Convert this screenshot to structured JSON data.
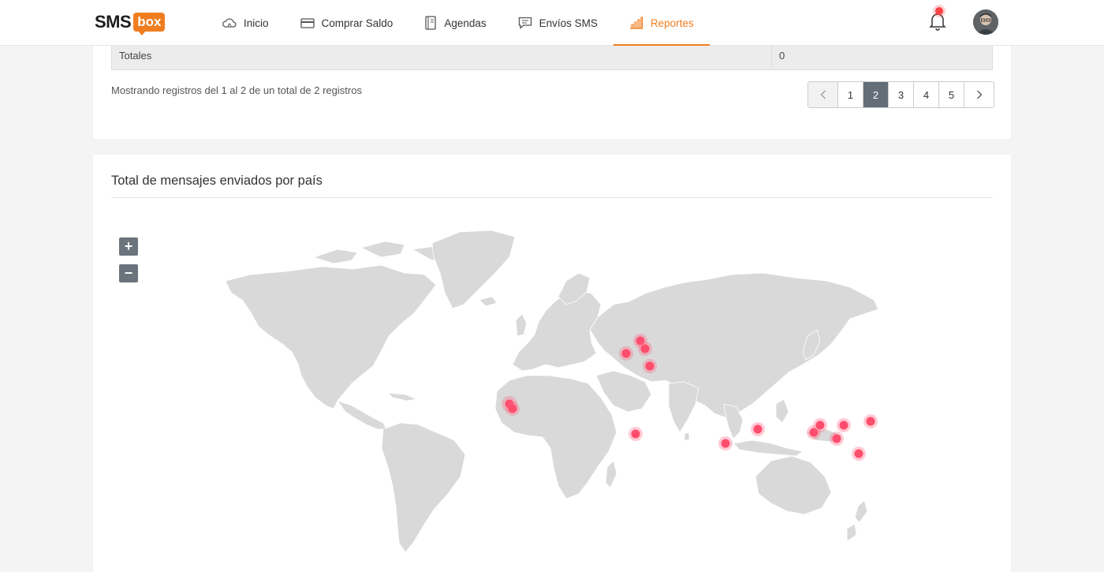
{
  "header": {
    "logo_main": "SMS",
    "logo_accent": "box",
    "nav": [
      {
        "label": "Inicio",
        "icon": "cloud-icon"
      },
      {
        "label": "Comprar Saldo",
        "icon": "credit-card-icon"
      },
      {
        "label": "Agendas",
        "icon": "address-book-icon"
      },
      {
        "label": "Envíos SMS",
        "icon": "message-icon"
      },
      {
        "label": "Reportes",
        "icon": "bar-chart-icon",
        "active": true
      }
    ],
    "accent_color": "#f07d1f"
  },
  "table": {
    "totals_label": "Totales",
    "totals_value": "0"
  },
  "pagination": {
    "summary": "Mostrando registros del 1 al 2 de un total de 2 registros",
    "pages": [
      "1",
      "2",
      "3",
      "4",
      "5"
    ],
    "current": "2"
  },
  "map_section": {
    "title": "Total de mensajes enviados por país",
    "zoom_in": "+",
    "zoom_out": "−",
    "marker_color": "#ff4d6d"
  }
}
